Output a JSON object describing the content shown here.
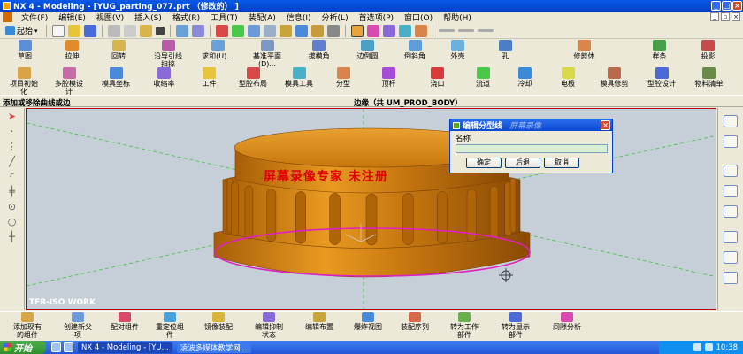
{
  "window": {
    "title": "NX 4 - Modeling - [YUG_parting_077.prt  （修改的） ]"
  },
  "menu": [
    "文件(F)",
    "编辑(E)",
    "视图(V)",
    "插入(S)",
    "格式(R)",
    "工具(T)",
    "装配(A)",
    "信息(I)",
    "分析(L)",
    "首选项(P)",
    "窗口(O)",
    "帮助(H)"
  ],
  "std_toolbar": {
    "start_label": "起始"
  },
  "toolbar_row1": [
    {
      "label": "草图",
      "icon": "sketch-icon",
      "color": "#5b8fd8"
    },
    {
      "label": "拉伸",
      "icon": "extrude-icon",
      "color": "#e28b2a"
    },
    {
      "label": "回转",
      "icon": "revolve-icon",
      "color": "#d8b44a"
    },
    {
      "label": "沿导引线\n扫掠",
      "icon": "sweep-icon",
      "color": "#b85aa8"
    },
    {
      "label": "求和(U)...",
      "icon": "unite-icon",
      "color": "#6aa0d8"
    },
    {
      "label": "基准平面\n(D)...",
      "icon": "datum-plane-icon",
      "color": "#7c98c4"
    },
    {
      "label": "拔模角",
      "icon": "draft-icon",
      "color": "#5e7ed0"
    },
    {
      "label": "边倒圆",
      "icon": "edge-blend-icon",
      "color": "#4aa0c8"
    },
    {
      "label": "倒斜角",
      "icon": "chamfer-icon",
      "color": "#5e9ed8"
    },
    {
      "label": "外壳",
      "icon": "shell-icon",
      "color": "#6ab0d8"
    },
    {
      "label": "孔",
      "icon": "hole-icon",
      "color": "#4a7ec8"
    },
    {
      "label": "修剪体",
      "icon": "trim-body-icon",
      "color": "#d8864a"
    },
    {
      "label": "样条",
      "icon": "spline-icon",
      "color": "#4aa04a"
    },
    {
      "label": "投影",
      "icon": "project-icon",
      "color": "#c84a4a"
    }
  ],
  "toolbar_row2": [
    {
      "label": "项目初始\n化",
      "icon": "project-init-icon",
      "color": "#d8a44a"
    },
    {
      "label": "多腔模设\n计",
      "icon": "family-mold-icon",
      "color": "#c86aa8"
    },
    {
      "label": "模具坐标",
      "icon": "mold-csys-icon",
      "color": "#4a8ad8"
    },
    {
      "label": "收缩率",
      "icon": "shrinkage-icon",
      "color": "#8a6ad8"
    },
    {
      "label": "工件",
      "icon": "workpiece-icon",
      "color": "#e8c43a"
    },
    {
      "label": "型腔布局",
      "icon": "cavity-layout-icon",
      "color": "#d84a4a"
    },
    {
      "label": "模具工具",
      "icon": "mold-tools-icon",
      "color": "#4ab0c8"
    },
    {
      "label": "分型",
      "icon": "parting-icon",
      "color": "#d8844a"
    },
    {
      "label": "顶杆",
      "icon": "ejector-pin-icon",
      "color": "#a84ad8"
    },
    {
      "label": "浇口",
      "icon": "gate-icon",
      "color": "#d83a3a"
    },
    {
      "label": "流道",
      "icon": "runner-icon",
      "color": "#4ac84a"
    },
    {
      "label": "冷却",
      "icon": "cooling-icon",
      "color": "#3a8ad8"
    },
    {
      "label": "电极",
      "icon": "electrode-icon",
      "color": "#d8d84a"
    },
    {
      "label": "模具修剪",
      "icon": "mold-trim-icon",
      "color": "#b86a4a"
    },
    {
      "label": "型腔设计",
      "icon": "cavity-design-icon",
      "color": "#4a6ad8"
    },
    {
      "label": "物料清单",
      "icon": "bom-icon",
      "color": "#6a8a4a"
    }
  ],
  "selection_bar": {
    "prompt": "添加或移除曲线或边",
    "status": "边缘（共 UM_PROD_BODY）"
  },
  "viewport": {
    "view_label": "TFR-ISO WORK",
    "watermark": "屏幕录像专家  未注册",
    "body_color": "#d88a10",
    "parting_line_color": "#e020c0"
  },
  "dialog": {
    "title": "编辑分型线",
    "title_watermark": "屏幕录像",
    "field_label": "名称",
    "field_value": "",
    "ok": "确定",
    "back": "后退",
    "cancel": "取消"
  },
  "bottom_toolbar": [
    {
      "label": "添加现有\n的组件",
      "icon": "add-component-icon",
      "color": "#d8a44a"
    },
    {
      "label": "创建新父\n项",
      "icon": "new-parent-icon",
      "color": "#6a9ad8"
    },
    {
      "label": "配对组件",
      "icon": "mate-component-icon",
      "color": "#d84a6a"
    },
    {
      "label": "重定位组\n件",
      "icon": "reposition-icon",
      "color": "#4aa0d8"
    },
    {
      "label": "镜像装配",
      "icon": "mirror-assembly-icon",
      "color": "#d8b43a"
    },
    {
      "label": "编辑抑制\n状态",
      "icon": "suppression-icon",
      "color": "#8a6ad8"
    },
    {
      "label": "编辑布置",
      "icon": "arrangement-icon",
      "color": "#c8a43a"
    },
    {
      "label": "爆炸视图",
      "icon": "exploded-view-icon",
      "color": "#4a8ad8"
    },
    {
      "label": "装配序列",
      "icon": "sequence-icon",
      "color": "#d86a4a"
    },
    {
      "label": "转为工作\n部件",
      "icon": "make-work-part-icon",
      "color": "#6ab04a"
    },
    {
      "label": "转为显示\n部件",
      "icon": "make-displayed-icon",
      "color": "#4a6ad8"
    },
    {
      "label": "间隙分析",
      "icon": "clearance-icon",
      "color": "#d84ab0"
    }
  ],
  "taskbar": {
    "start": "开始",
    "tasks": [
      "NX 4 - Modeling - [YU...",
      "凌波多媒体教学网..."
    ],
    "clock": "10:38"
  }
}
